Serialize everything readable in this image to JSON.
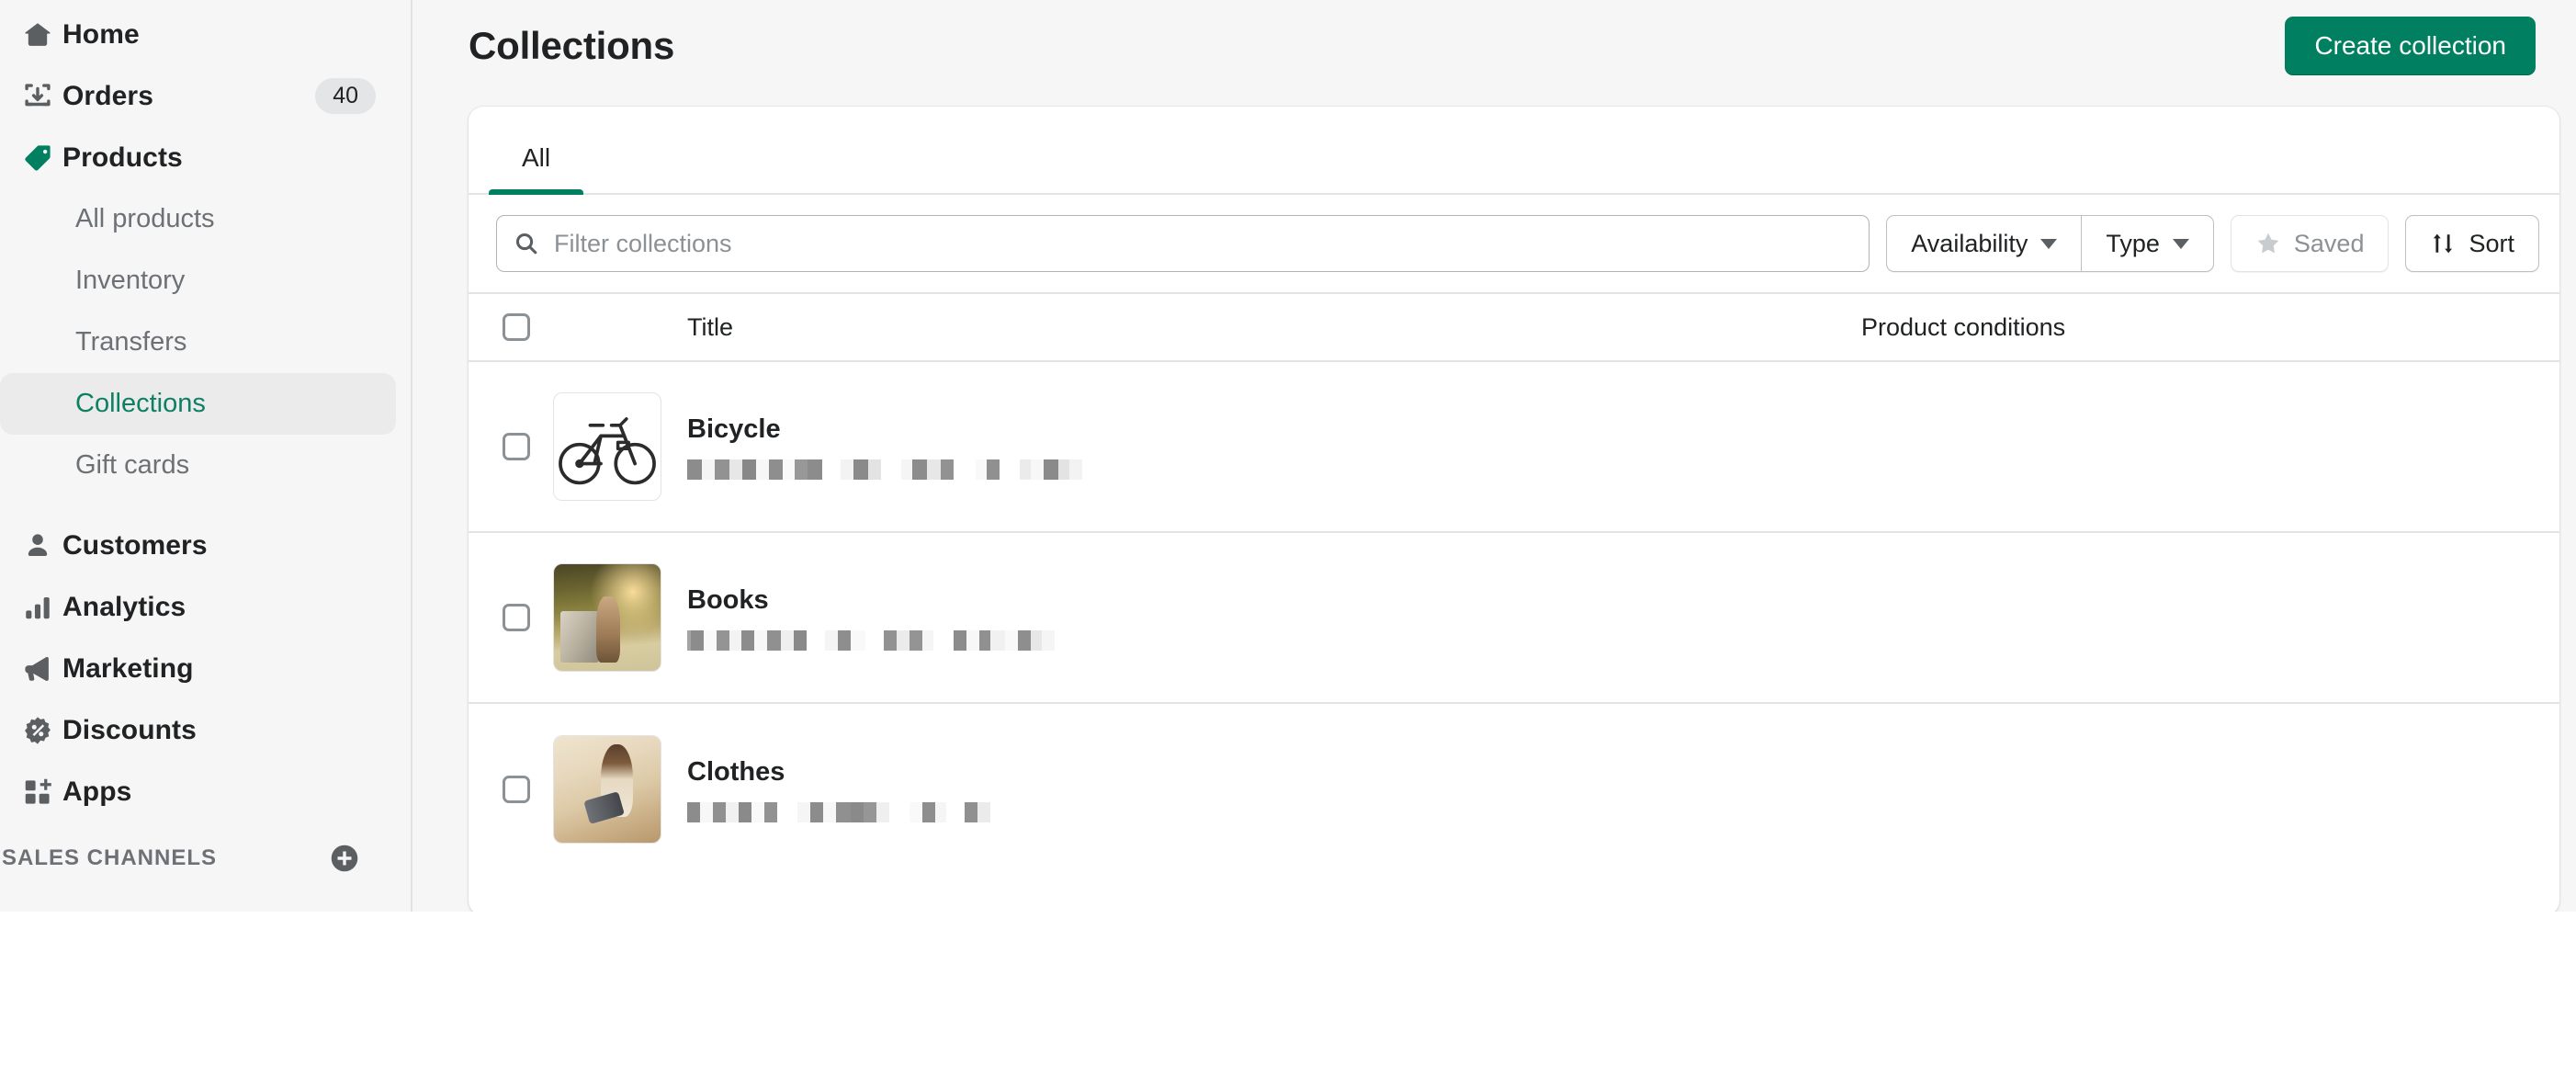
{
  "sidebar": {
    "items": [
      {
        "label": "Home",
        "icon": "home-icon",
        "badge": null
      },
      {
        "label": "Orders",
        "icon": "orders-icon",
        "badge": "40"
      },
      {
        "label": "Products",
        "icon": "products-tag-icon",
        "badge": null
      }
    ],
    "product_subitems": [
      {
        "label": "All products",
        "active": false
      },
      {
        "label": "Inventory",
        "active": false
      },
      {
        "label": "Transfers",
        "active": false
      },
      {
        "label": "Collections",
        "active": true
      },
      {
        "label": "Gift cards",
        "active": false
      }
    ],
    "items_lower": [
      {
        "label": "Customers",
        "icon": "customer-person-icon"
      },
      {
        "label": "Analytics",
        "icon": "analytics-bars-icon"
      },
      {
        "label": "Marketing",
        "icon": "marketing-megaphone-icon"
      },
      {
        "label": "Discounts",
        "icon": "discounts-percent-icon"
      },
      {
        "label": "Apps",
        "icon": "apps-grid-plus-icon"
      }
    ],
    "sales_channels": {
      "title": "SALES CHANNELS",
      "add_icon": "plus-circle-icon"
    }
  },
  "header": {
    "title": "Collections",
    "create_button": "Create collection"
  },
  "tabs": [
    {
      "label": "All",
      "active": true
    }
  ],
  "filters": {
    "search_placeholder": "Filter collections",
    "search_value": "",
    "search_icon": "search-icon",
    "availability_label": "Availability",
    "type_label": "Type",
    "saved_label": "Saved",
    "saved_icon": "star-icon",
    "sort_label": "Sort",
    "sort_icon": "sort-arrows-icon"
  },
  "table": {
    "columns": {
      "title": "Title",
      "product_conditions": "Product conditions"
    },
    "rows": [
      {
        "title": "Bicycle",
        "thumbnail": "bicycle-thumbnail",
        "subtitle_redacted": true,
        "product_conditions": ""
      },
      {
        "title": "Books",
        "thumbnail": "books-photo-thumbnail",
        "subtitle_redacted": true,
        "product_conditions": ""
      },
      {
        "title": "Clothes",
        "thumbnail": "clothes-photo-thumbnail",
        "subtitle_redacted": true,
        "product_conditions": ""
      }
    ]
  },
  "colors": {
    "brand_green": "#008060",
    "active_link_green": "#0E8062",
    "sidebar_bg": "#F6F6F7",
    "text_primary": "#202223",
    "text_subdued": "#6D7175",
    "border": "#E1E3E5"
  }
}
